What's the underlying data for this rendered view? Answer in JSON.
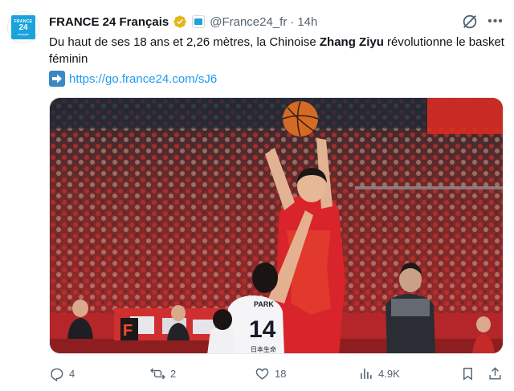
{
  "account": {
    "avatar_line1": "FRANCE",
    "avatar_line2": "24",
    "avatar_line3": "français",
    "display_name": "FRANCE 24 Français",
    "handle": "@France24_fr",
    "separator": "·",
    "time": "14h"
  },
  "tweet": {
    "text_before": "Du haut de ses 18 ans et 2,26 mètres, la Chinoise ",
    "text_bold": "Zhang Ziyu",
    "text_after": " révolutionne le basket féminin",
    "link": "https://go.france24.com/sJ6"
  },
  "photo": {
    "jersey_number": "14",
    "jersey_name": "PARK",
    "jersey_sub": "日本生命"
  },
  "actions": {
    "replies": "4",
    "reposts": "2",
    "likes": "18",
    "views": "4.9K"
  },
  "icons": {
    "verified": "verified-badge-icon",
    "affiliate": "affiliate-badge-icon",
    "grok": "grok-icon",
    "more": "more-icon",
    "link_arrow": "right-arrow-icon",
    "reply": "reply-icon",
    "repost": "repost-icon",
    "like": "like-icon",
    "views": "views-icon",
    "bookmark": "bookmark-icon",
    "share": "share-icon"
  },
  "colors": {
    "brand_blue": "#1aa3dd",
    "link_blue": "#1d9bf0",
    "verified_gold": "#e2b719",
    "muted_text": "#536471"
  }
}
